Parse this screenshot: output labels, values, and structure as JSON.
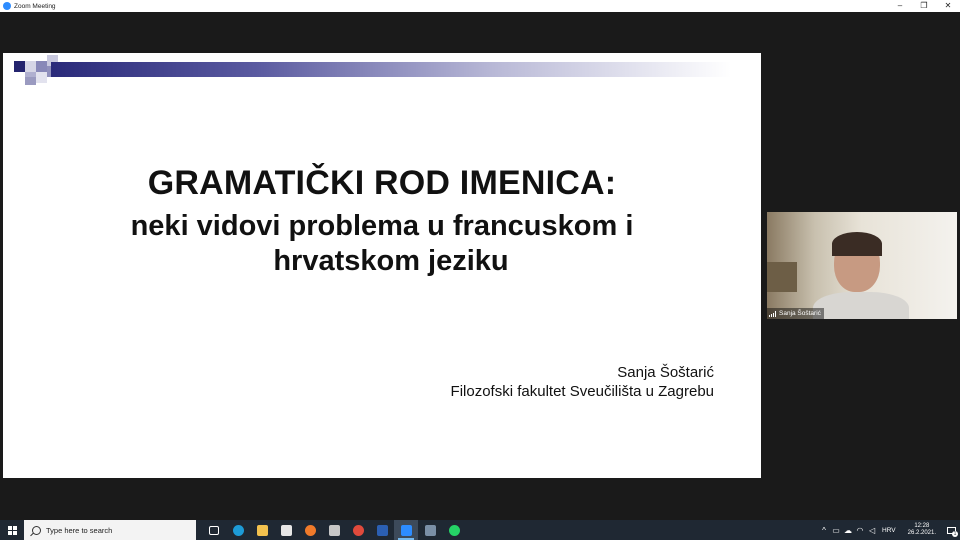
{
  "window": {
    "title": "Zoom Meeting",
    "minimize": "–",
    "restore": "❐",
    "close": "✕"
  },
  "slide": {
    "title_line1": "GRAMATIČKI ROD IMENICA:",
    "title_line2": "neki vidovi problema u francuskom i",
    "title_line3": "hrvatskom jeziku",
    "author": "Sanja Šoštarić",
    "affiliation": "Filozofski fakultet Sveučilišta u Zagrebu",
    "banner_color": "#2a2a7a"
  },
  "participant": {
    "name": "Sanja Šoštarić"
  },
  "taskbar": {
    "search_placeholder": "Type here to search",
    "apps": [
      {
        "name": "task-view-icon",
        "color": "#ffffff"
      },
      {
        "name": "edge-icon",
        "color": "#1d9bd7"
      },
      {
        "name": "file-explorer-icon",
        "color": "#f2c14e"
      },
      {
        "name": "store-icon",
        "color": "#e6e6e6"
      },
      {
        "name": "firefox-icon",
        "color": "#f07a2a"
      },
      {
        "name": "app-icon",
        "color": "#c7c7c7"
      },
      {
        "name": "chrome-icon",
        "color": "#e04a3c"
      },
      {
        "name": "word-icon",
        "color": "#2b5fb3"
      },
      {
        "name": "zoom-icon",
        "color": "#2d8cff"
      },
      {
        "name": "calculator-icon",
        "color": "#7a8fa6"
      },
      {
        "name": "whatsapp-icon",
        "color": "#25d366"
      }
    ],
    "language": "HRV",
    "time": "12:28",
    "date": "26.2.2021.",
    "notification_count": "1"
  }
}
